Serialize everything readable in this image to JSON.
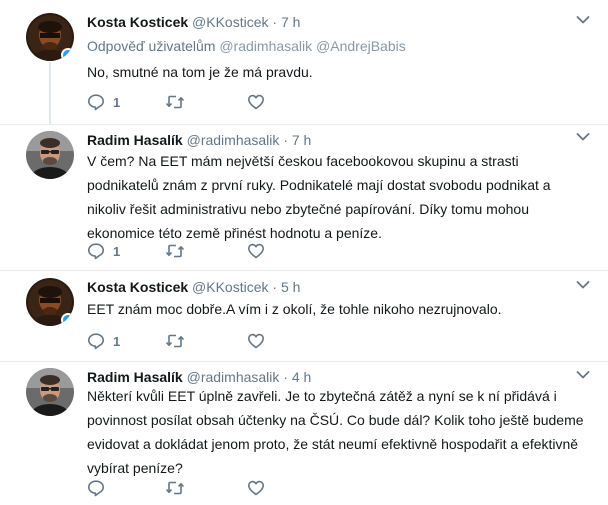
{
  "tweets": [
    {
      "name": "Kosta Kosticek",
      "handle": "@KKosticek",
      "dot": "·",
      "time": "7 h",
      "reply_prefix": "Odpověď uživatelům",
      "reply_mentions": "@radimhasalik @AndrejBabis",
      "text": "No, smutné na tom je že má pravdu.",
      "reply_count": "1",
      "avatar": "kosta-avatar"
    },
    {
      "name": "Radim Hasalík",
      "handle": "@radimhasalik",
      "dot": "·",
      "time": "7 h",
      "text": "V čem? Na EET mám největší českou facebookovou skupinu a strasti podnikatelů znám z první ruky. Podnikatelé mají dostat svobodu podnikat a nikoliv řešit administrativu nebo zbytečné papírování. Díky tomu mohou ekonomice této země přinést hodnotu a peníze.",
      "reply_count": "1",
      "avatar": "radim-avatar"
    },
    {
      "name": "Kosta Kosticek",
      "handle": "@KKosticek",
      "dot": "·",
      "time": "5 h",
      "text": "EET znám moc dobře.A vím i z okolí, že tohle nikoho nezrujnovalo.",
      "reply_count": "1",
      "avatar": "kosta-avatar"
    },
    {
      "name": "Radim Hasalík",
      "handle": "@radimhasalik",
      "dot": "·",
      "time": "4 h",
      "text": "Některí kvůli EET úplně zavřeli. Je to zbytečná zátěž a nyní se k ní přidává i povinnost posílat obsah účtenky na ČSÚ. Co bude dál? Kolik toho ještě budeme evidovat a dokládat jenom proto, že stát neumí efektivně hospodařit a efektivně vybírat peníze?",
      "reply_count": "",
      "avatar": "radim-avatar"
    }
  ],
  "colors": {
    "text_primary": "#14171a",
    "text_secondary": "#657786",
    "icon": "#657786",
    "verified": "#1da1f2",
    "divider": "#e6ecf0"
  }
}
